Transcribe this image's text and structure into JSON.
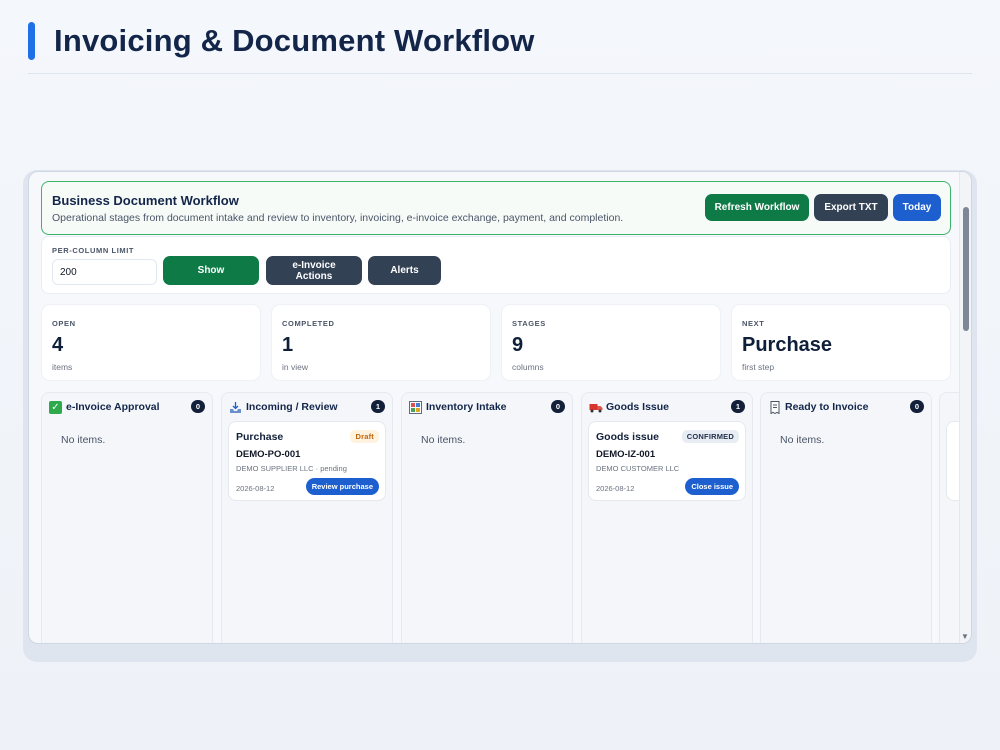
{
  "page": {
    "title": "Invoicing & Document Workflow"
  },
  "banner": {
    "title": "Business Document Workflow",
    "description": "Operational stages from document intake and review to inventory, invoicing, e-invoice exchange, payment, and completion.",
    "buttons": {
      "refresh": "Refresh Workflow",
      "export": "Export TXT",
      "today": "Today"
    }
  },
  "controls": {
    "limit_label": "PER-COLUMN LIMIT",
    "limit_value": "200",
    "show": "Show",
    "einvoice_actions": "e-Invoice Actions",
    "alerts": "Alerts"
  },
  "stats": [
    {
      "label": "OPEN",
      "value": "4",
      "sub": "items"
    },
    {
      "label": "COMPLETED",
      "value": "1",
      "sub": "in view"
    },
    {
      "label": "STAGES",
      "value": "9",
      "sub": "columns"
    },
    {
      "label": "NEXT",
      "value": "Purchase",
      "sub": "first step"
    }
  ],
  "columns": [
    {
      "title": "e-Invoice Approval",
      "icon": "check-box-icon",
      "count": "0",
      "empty_text": "No items."
    },
    {
      "title": "Incoming / Review",
      "icon": "inbox-tray-icon",
      "count": "1",
      "card": {
        "type": "Purchase",
        "status": "Draft",
        "id": "DEMO-PO-001",
        "party": "DEMO SUPPLIER LLC · pending",
        "date": "2026-08-12",
        "action": "Review purchase"
      }
    },
    {
      "title": "Inventory Intake",
      "icon": "shelves-icon",
      "count": "0",
      "empty_text": "No items."
    },
    {
      "title": "Goods Issue",
      "icon": "truck-icon",
      "count": "1",
      "card": {
        "type": "Goods issue",
        "status": "CONFIRMED",
        "id": "DEMO-IZ-001",
        "party": "DEMO CUSTOMER LLC",
        "date": "2026-08-12",
        "action": "Close issue"
      }
    },
    {
      "title": "Ready to Invoice",
      "icon": "receipt-icon",
      "count": "0",
      "empty_text": "No items."
    }
  ],
  "colors": {
    "accent": "#1f6fe8",
    "primary_green": "#0e7a46",
    "dark_button": "#334155",
    "blue_button": "#1d5fcf",
    "banner_border": "#3bb36a"
  }
}
